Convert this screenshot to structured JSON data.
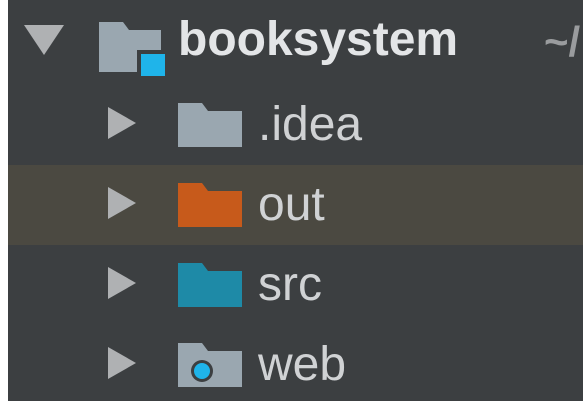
{
  "project_tree": {
    "root": {
      "label": "booksystem",
      "path_hint": "~/",
      "expanded": true,
      "icon": "project-folder-icon"
    },
    "items": [
      {
        "label": ".idea",
        "icon": "folder-icon",
        "color": "#9aa7b0",
        "selected": false
      },
      {
        "label": "out",
        "icon": "excluded-folder-icon",
        "color": "#c75a1b",
        "selected": true
      },
      {
        "label": "src",
        "icon": "source-folder-icon",
        "color": "#1e8aa7",
        "selected": false
      },
      {
        "label": "web",
        "icon": "web-folder-icon",
        "color": "#9aa7b0",
        "selected": false
      }
    ]
  },
  "colors": {
    "background": "#3c3f41",
    "selection": "#4b4941",
    "badge_blue": "#1fb4ea"
  }
}
